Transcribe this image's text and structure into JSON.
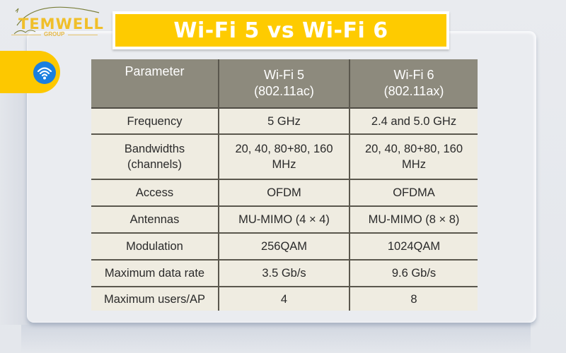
{
  "brand": {
    "name": "TEMWELL",
    "sub": "GROUP"
  },
  "title": "Wi-Fi 5 vs Wi-Fi 6",
  "icons": {
    "badge": "wifi-icon"
  },
  "colors": {
    "accent_yellow": "#fecb00",
    "wifi_blue": "#1a7fe0",
    "table_header": "#8d8a7d",
    "table_body": "#efece1"
  },
  "table": {
    "headers": [
      {
        "line1": "Parameter",
        "line2": ""
      },
      {
        "line1": "Wi-Fi 5",
        "line2": "(802.11ac)"
      },
      {
        "line1": "Wi-Fi 6",
        "line2": "(802.11ax)"
      }
    ],
    "rows": [
      {
        "param": "Frequency",
        "wifi5": "5 GHz",
        "wifi6": "2.4 and 5.0 GHz"
      },
      {
        "param": "Bandwidths (channels)",
        "wifi5": "20, 40, 80+80, 160 MHz",
        "wifi6": "20, 40, 80+80, 160 MHz"
      },
      {
        "param": "Access",
        "wifi5": "OFDM",
        "wifi6": "OFDMA"
      },
      {
        "param": "Antennas",
        "wifi5": "MU-MIMO (4 × 4)",
        "wifi6": "MU-MIMO (8 × 8)"
      },
      {
        "param": "Modulation",
        "wifi5": "256QAM",
        "wifi6": "1024QAM"
      },
      {
        "param": "Maximum data rate",
        "wifi5": "3.5 Gb/s",
        "wifi6": "9.6 Gb/s"
      },
      {
        "param": "Maximum users/AP",
        "wifi5": "4",
        "wifi6": "8"
      }
    ]
  }
}
